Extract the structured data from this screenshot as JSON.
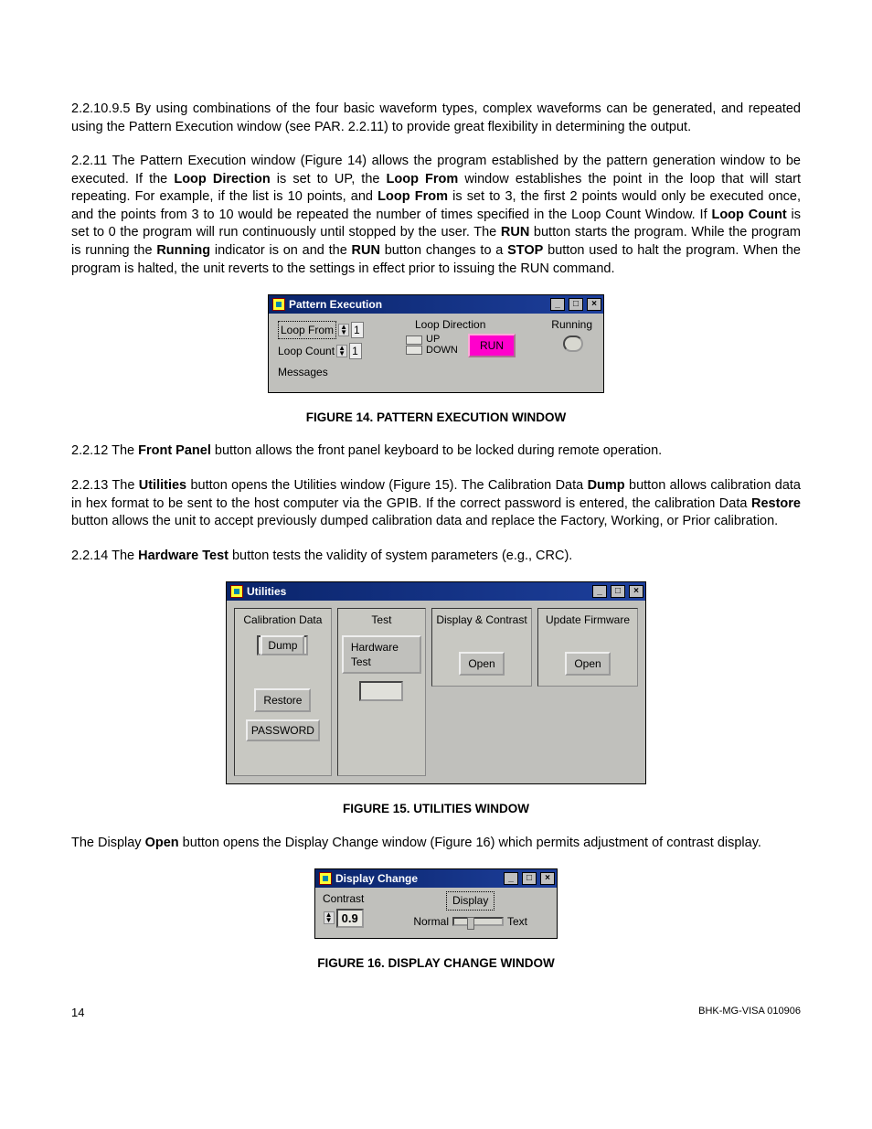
{
  "para1": {
    "prefix": "2.2.10.9.5 By using combinations of the four basic waveform types, complex waveforms can be generated, and repeated using the Pattern Execution window (see PAR. 2.2.11) to provide great flexibility in determining the output."
  },
  "para2": {
    "t1": "2.2.11  The Pattern Execution window (Figure 14) allows the program established by the pattern generation window to be executed. If the ",
    "b1": "Loop Direction",
    "t2": " is set to UP, the ",
    "b2": "Loop From",
    "t3": " window establishes the point in the loop that will start repeating. For example, if the list is 10 points, and ",
    "b3": "Loop From",
    "t4": " is set to 3, the first 2 points would only be executed once, and the points from 3 to 10 would be repeated the number of times specified in the Loop Count Window. If ",
    "b4": "Loop Count",
    "t5": " is set to 0 the program will run continuously until stopped by the user. The ",
    "b5": "RUN",
    "t6": " button starts the program. While the program is running the ",
    "b6": "Running",
    "t7": " indicator is on and the ",
    "b7": "RUN",
    "t8": " button changes to a ",
    "b8": "STOP",
    "t9": " button used to halt the program. When the program is halted, the unit reverts to the settings in effect prior to issuing the RUN command."
  },
  "fig14": {
    "title": "Pattern Execution",
    "loopFromLabel": "Loop From",
    "loopFromValue": "1",
    "loopCountLabel": "Loop Count",
    "loopCountValue": "1",
    "messagesLabel": "Messages",
    "loopDirectionLabel": "Loop Direction",
    "up": "UP",
    "down": "DOWN",
    "runBtn": "RUN",
    "runningLabel": "Running",
    "caption": "FIGURE 14.    PATTERN EXECUTION WINDOW"
  },
  "para3": {
    "t1": "2.2.12  The ",
    "b1": "Front Panel",
    "t2": " button allows the front panel keyboard to be locked during remote operation."
  },
  "para4": {
    "t1": "2.2.13  The ",
    "b1": "Utilities",
    "t2": " button opens the Utilities window (Figure 15). The Calibration Data ",
    "b2": "Dump",
    "t3": " button allows calibration data in hex format to be sent to the host computer via the GPIB. If the correct password is entered, the calibration Data ",
    "b3": "Restore",
    "t4": " button allows the unit to accept previously dumped calibration data and replace the Factory, Working, or Prior calibration."
  },
  "para5": {
    "t1": "2.2.14  The ",
    "b1": "Hardware Test",
    "t2": " button tests the validity of system parameters (e.g., CRC)."
  },
  "fig15": {
    "title": "Utilities",
    "cal": "Calibration Data",
    "dump": "Dump",
    "restore": "Restore",
    "password": "PASSWORD",
    "test": "Test",
    "hwtest": "Hardware Test",
    "disp": "Display & Contrast",
    "open1": "Open",
    "upd": "Update Firmware",
    "open2": "Open",
    "caption": "FIGURE 15.    UTILITIES WINDOW"
  },
  "para6": {
    "t1": "The Display ",
    "b1": "Open",
    "t2": " button opens the Display Change window (Figure 16) which permits adjustment of contrast display."
  },
  "fig16": {
    "title": "Display Change",
    "contrast": "Contrast",
    "value": "0.9",
    "displayBtn": "Display",
    "normal": "Normal",
    "text": "Text",
    "caption": "FIGURE 16.    DISPLAY CHANGE WINDOW"
  },
  "footer": {
    "page": "14",
    "doc": "BHK-MG-VISA 010906"
  },
  "winbtns": {
    "min": "_",
    "max": "□",
    "close": "×"
  }
}
